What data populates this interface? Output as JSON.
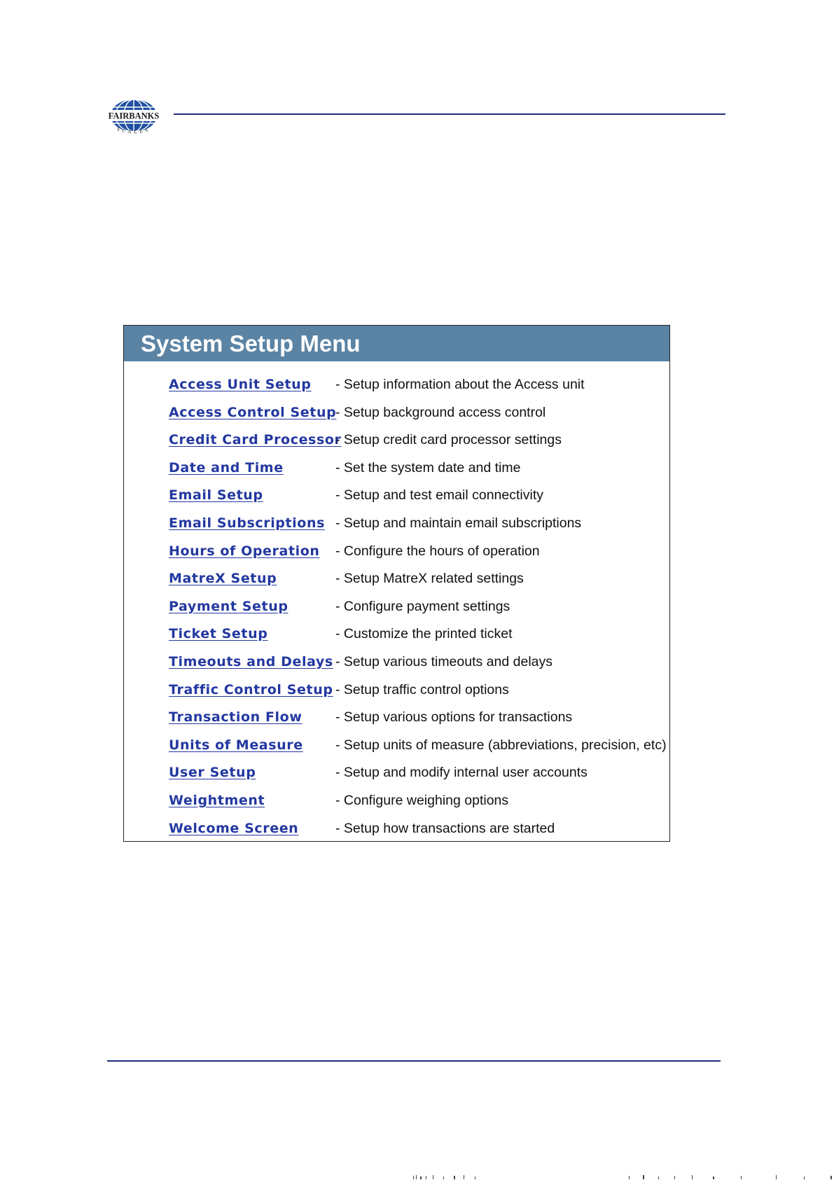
{
  "document": {
    "logo_text": "FAIRBANKS",
    "logo_subtext": "SCALES",
    "colors": {
      "rule": "#1f2e7a",
      "panel_header": "#5a83a4",
      "link": "#2338a0",
      "logo": "#1f4fa0"
    }
  },
  "panel": {
    "title": "System Setup Menu",
    "items": [
      {
        "link": "Access Unit Setup",
        "desc": "- Setup information about the Access unit"
      },
      {
        "link": "Access Control Setup",
        "desc": "- Setup background access control"
      },
      {
        "link": "Credit Card Processor",
        "desc": "- Setup credit card processor settings"
      },
      {
        "link": "Date and Time",
        "desc": "- Set the system date and time"
      },
      {
        "link": "Email Setup",
        "desc": "- Setup and test email connectivity"
      },
      {
        "link": "Email Subscriptions",
        "desc": "- Setup and maintain email subscriptions"
      },
      {
        "link": "Hours of Operation",
        "desc": "- Configure the hours of operation"
      },
      {
        "link": "MatreX Setup",
        "desc": "- Setup MatreX related settings"
      },
      {
        "link": "Payment Setup",
        "desc": "- Configure payment settings"
      },
      {
        "link": "Ticket Setup",
        "desc": "- Customize the printed ticket"
      },
      {
        "link": "Timeouts and Delays",
        "desc": "- Setup various timeouts and delays"
      },
      {
        "link": "Traffic Control Setup",
        "desc": "- Setup traffic control options"
      },
      {
        "link": "Transaction Flow",
        "desc": "- Setup various options for transactions"
      },
      {
        "link": "Units of Measure",
        "desc": "- Setup units of measure (abbreviations, precision, etc)"
      },
      {
        "link": "User Setup",
        "desc": "- Setup and modify internal user accounts"
      },
      {
        "link": "Weightment",
        "desc": "- Configure weighing options"
      },
      {
        "link": "Welcome Screen",
        "desc": "- Setup how transactions are started"
      }
    ]
  }
}
